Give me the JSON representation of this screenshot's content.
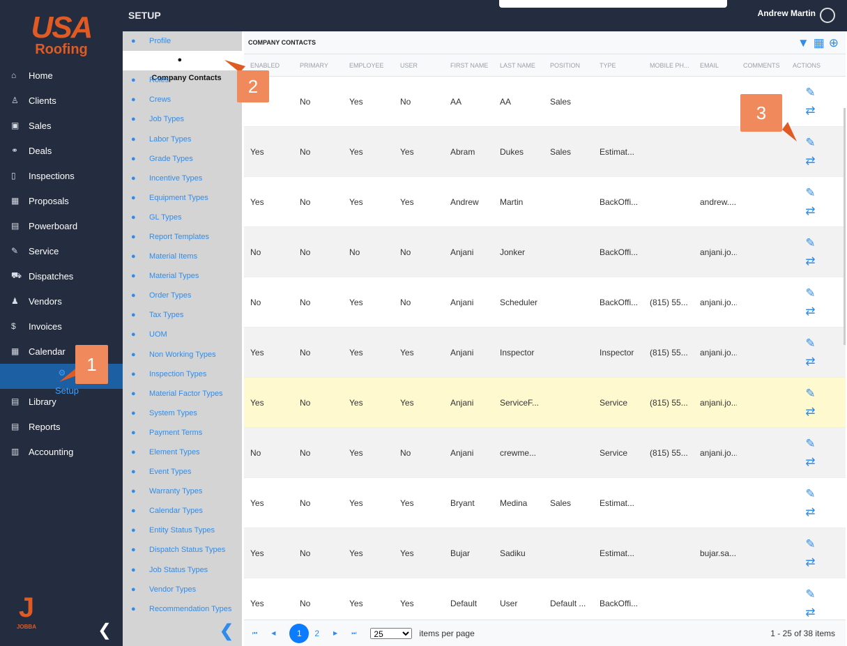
{
  "brand": {
    "logo_text": "USA",
    "logo_sub": "Roofing",
    "footer_logo": "J",
    "footer_sub": "JOBBA"
  },
  "header": {
    "title": "SETUP",
    "user": "Andrew Martin"
  },
  "nav": [
    {
      "label": "Home",
      "icon": "home-icon",
      "g": "⌂"
    },
    {
      "label": "Clients",
      "icon": "user-icon",
      "g": "♙"
    },
    {
      "label": "Sales",
      "icon": "briefcase-icon",
      "g": "▣"
    },
    {
      "label": "Deals",
      "icon": "handshake-icon",
      "g": "⚭"
    },
    {
      "label": "Inspections",
      "icon": "clipboard-icon",
      "g": "▯"
    },
    {
      "label": "Proposals",
      "icon": "calculator-icon",
      "g": "▦"
    },
    {
      "label": "Powerboard",
      "icon": "clipboard-list-icon",
      "g": "▤"
    },
    {
      "label": "Service",
      "icon": "wrench-icon",
      "g": "✎"
    },
    {
      "label": "Dispatches",
      "icon": "truck-icon",
      "g": "⛟"
    },
    {
      "label": "Vendors",
      "icon": "users-icon",
      "g": "♟"
    },
    {
      "label": "Invoices",
      "icon": "dollar-icon",
      "g": "$"
    },
    {
      "label": "Calendar",
      "icon": "calendar-icon",
      "g": "▦"
    },
    {
      "label": "Setup",
      "icon": "gear-icon",
      "g": "⚙",
      "active": true
    },
    {
      "label": "Library",
      "icon": "book-icon",
      "g": "▤"
    },
    {
      "label": "Reports",
      "icon": "report-icon",
      "g": "▤"
    },
    {
      "label": "Accounting",
      "icon": "bank-icon",
      "g": "▥"
    }
  ],
  "submenu": [
    "Profile",
    "Company Contacts",
    "Roles",
    "Crews",
    "Job Types",
    "Labor Types",
    "Grade Types",
    "Incentive Types",
    "Equipment Types",
    "GL Types",
    "Report Templates",
    "Material Items",
    "Material Types",
    "Order Types",
    "Tax Types",
    "UOM",
    "Non Working Types",
    "Inspection Types",
    "Material Factor Types",
    "System Types",
    "Payment Terms",
    "Element Types",
    "Event Types",
    "Warranty Types",
    "Calendar Types",
    "Entity Status Types",
    "Dispatch Status Types",
    "Job Status Types",
    "Vendor Types",
    "Recommendation Types"
  ],
  "submenu_active": 1,
  "table": {
    "title": "COMPANY CONTACTS",
    "columns": [
      "ENABLED",
      "PRIMARY",
      "EMPLOYEE",
      "USER",
      "FIRST NAME",
      "LAST NAME",
      "POSITION",
      "TYPE",
      "MOBILE PH...",
      "EMAIL",
      "COMMENTS",
      "ACTIONS"
    ],
    "rows": [
      [
        "",
        "No",
        "Yes",
        "No",
        "AA",
        "AA",
        "Sales",
        "",
        "",
        "",
        ""
      ],
      [
        "Yes",
        "No",
        "Yes",
        "Yes",
        "Abram",
        "Dukes",
        "Sales",
        "Estimat...",
        "",
        "",
        ""
      ],
      [
        "Yes",
        "No",
        "Yes",
        "Yes",
        "Andrew",
        "Martin",
        "",
        "BackOffi...",
        "",
        "andrew....",
        ""
      ],
      [
        "No",
        "No",
        "No",
        "No",
        "Anjani",
        "Jonker",
        "",
        "BackOffi...",
        "",
        "anjani.jo...",
        ""
      ],
      [
        "No",
        "No",
        "Yes",
        "No",
        "Anjani",
        "Scheduler",
        "",
        "BackOffi...",
        "(815) 55...",
        "anjani.jo...",
        ""
      ],
      [
        "Yes",
        "No",
        "Yes",
        "Yes",
        "Anjani",
        "Inspector",
        "",
        "Inspector",
        "(815) 55...",
        "anjani.jo...",
        ""
      ],
      [
        "Yes",
        "No",
        "Yes",
        "Yes",
        "Anjani",
        "ServiceF...",
        "",
        "Service",
        "(815) 55...",
        "anjani.jo...",
        ""
      ],
      [
        "No",
        "No",
        "Yes",
        "No",
        "Anjani",
        "crewme...",
        "",
        "Service",
        "(815) 55...",
        "anjani.jo...",
        ""
      ],
      [
        "Yes",
        "No",
        "Yes",
        "Yes",
        "Bryant",
        "Medina",
        "Sales",
        "Estimat...",
        "",
        "",
        ""
      ],
      [
        "Yes",
        "No",
        "Yes",
        "Yes",
        "Bujar",
        "Sadiku",
        "",
        "Estimat...",
        "",
        "bujar.sa...",
        ""
      ],
      [
        "Yes",
        "No",
        "Yes",
        "Yes",
        "Default",
        "User",
        "Default ...",
        "BackOffi...",
        "",
        "",
        ""
      ]
    ],
    "highlighted_row": 6
  },
  "pager": {
    "pages": [
      "1",
      "2"
    ],
    "current": "1",
    "page_size": "25",
    "per_page_label": "items per page",
    "count": "1 - 25 of 38 items"
  },
  "callouts": [
    "1",
    "2",
    "3"
  ],
  "colors": {
    "sidebar": "#232d3f",
    "accent": "#2f8ceb",
    "callout": "#f08a5d",
    "highlight": "#fff9cf"
  }
}
